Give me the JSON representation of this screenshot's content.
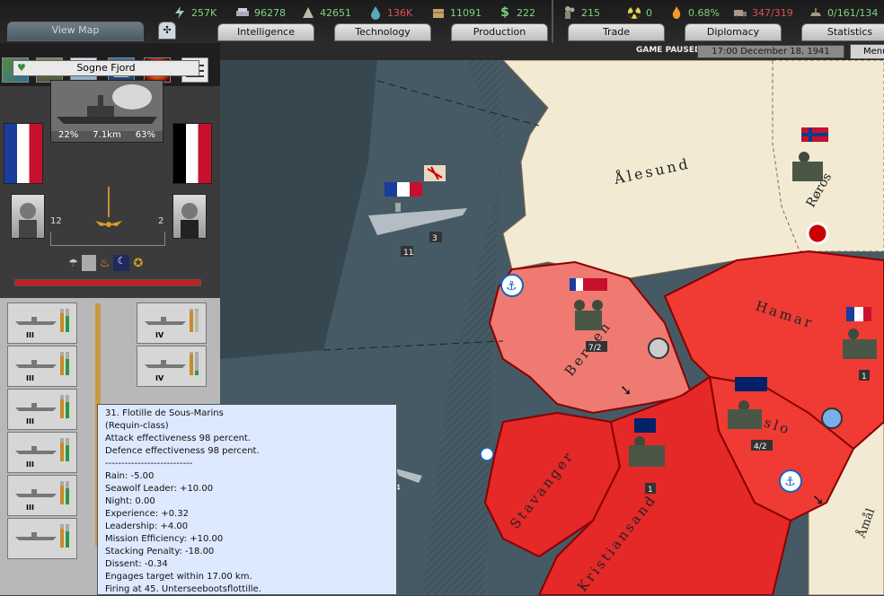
{
  "resources": [
    {
      "name": "energy-icon",
      "value": "257K",
      "color": "green"
    },
    {
      "name": "metal-icon",
      "value": "96278",
      "color": "green"
    },
    {
      "name": "rare-materials-icon",
      "value": "42651",
      "color": "green"
    },
    {
      "name": "oil-icon",
      "value": "136K",
      "color": "red"
    },
    {
      "name": "supplies-icon",
      "value": "11091",
      "color": "green"
    },
    {
      "name": "money-icon",
      "value": "222",
      "color": "green"
    },
    {
      "name": "manpower-icon",
      "value": "215",
      "color": "green"
    },
    {
      "name": "nuclear-icon",
      "value": "0",
      "color": "green"
    },
    {
      "name": "dissent-icon",
      "value": "0.68%",
      "color": "green"
    },
    {
      "name": "transport-icon",
      "value": "347/319",
      "color": "red"
    },
    {
      "name": "escort-icon",
      "value": "0/161/134",
      "color": "green"
    }
  ],
  "tabs": {
    "view_map": "View Map",
    "intelligence": "Intelligence",
    "technology": "Technology",
    "production": "Production",
    "trade": "Trade",
    "diplomacy": "Diplomacy",
    "statistics": "Statistics"
  },
  "status": {
    "paused": "GAME PAUSED",
    "date": "17:00 December 18, 1941",
    "menu": "Menu"
  },
  "panel": {
    "location": "Sogne Fjord",
    "battle_left": "22%",
    "battle_distance": "7.1km",
    "battle_right": "63%",
    "left_count": "12",
    "right_count": "2"
  },
  "units_left": [
    {
      "rank": "III"
    },
    {
      "rank": "III"
    },
    {
      "rank": "III"
    },
    {
      "rank": "III"
    },
    {
      "rank": "III"
    },
    {
      "rank": ""
    }
  ],
  "units_right": [
    {
      "rank": "IV"
    },
    {
      "rank": "IV"
    }
  ],
  "map": {
    "provinces": [
      "Ålesund",
      "Røros",
      "Bergen",
      "Hamar",
      "Oslo",
      "Stavanger",
      "Kristiansand",
      "Åmål"
    ],
    "counters": [
      "3",
      "11",
      "7/2",
      "1",
      "4/2",
      "1",
      "4"
    ]
  },
  "tooltip": [
    "31. Flotille de Sous-Marins",
    "(Requin-class)",
    "Attack effectiveness 98 percent.",
    "Defence effectiveness 98 percent.",
    "---------------------------",
    "Rain: -5.00",
    "Seawolf Leader: +10.00",
    "Night: 0.00",
    "Experience: +0.32",
    "Leadership: +4.00",
    "Mission Efficiency: +10.00",
    "Stacking Penalty: -18.00",
    "Dissent: -0.34",
    "Engages target within 17.00 km.",
    "Firing at 45. Unterseebootsflottille."
  ]
}
